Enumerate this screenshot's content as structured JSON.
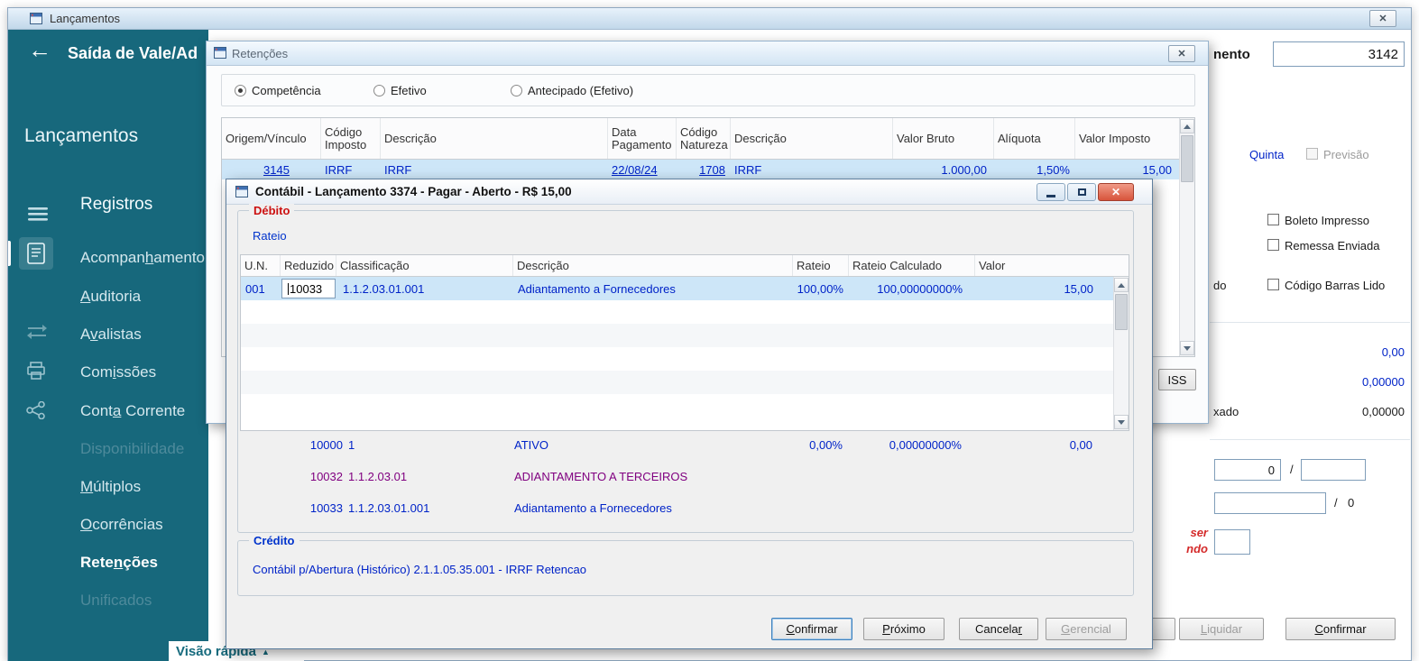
{
  "colors": {
    "sidebar_teal": "#17687c",
    "selection_blue": "#cde6f8",
    "link_blue": "#0023c8",
    "debito_red": "#cc1111",
    "credito_blue": "#0033cc",
    "detail_purple": "#800080",
    "close_red": "#d8543c"
  },
  "main_window": {
    "title": "Lançamentos",
    "close_glyph": "✕"
  },
  "sidebar": {
    "back_glyph": "←",
    "header": "Saída de Vale/Ad",
    "title": "Lançamentos",
    "section": "Registros",
    "items": [
      {
        "label": "Acompan_hamento",
        "state": "normal"
      },
      {
        "label": "_Auditoria",
        "state": "normal"
      },
      {
        "label": "A_valistas",
        "state": "normal"
      },
      {
        "label": "Com_issões",
        "state": "normal"
      },
      {
        "label": "Cont_a Corrente",
        "state": "normal"
      },
      {
        "label": "Disponibilidade",
        "state": "disabled"
      },
      {
        "label": "_Múltiplos",
        "state": "normal"
      },
      {
        "label": "_Ocorrências",
        "state": "normal"
      },
      {
        "label": "Rete_nções",
        "state": "selected"
      },
      {
        "label": "Unificados",
        "state": "disabled"
      }
    ],
    "footer": "Visão rápida",
    "footer_glyph": "▲"
  },
  "retencoes": {
    "title": "Retenções",
    "close_glyph": "✕",
    "radios": [
      {
        "label": "Competência",
        "checked": true
      },
      {
        "label": "Efetivo",
        "checked": false
      },
      {
        "label": "Antecipado (Efetivo)",
        "checked": false
      }
    ],
    "grid": {
      "columns": [
        "Origem/Vínculo",
        "Código\nImposto",
        "Descrição",
        "Data\nPagamento",
        "Código\nNatureza",
        "Descrição",
        "Valor Bruto",
        "Alíquota",
        "Valor Imposto"
      ],
      "row": [
        "3145",
        "IRRF",
        "IRRF",
        "22/08/24",
        "1708",
        "IRRF",
        "1.000,00",
        "1,50%",
        "15,00"
      ]
    },
    "iss_button": "ISS"
  },
  "contabil": {
    "title": "Contábil - Lançamento 3374 - Pagar - Aberto - R$ 15,00",
    "close_glyph": "✕",
    "debito_label": "Débito",
    "rateio_label": "Rateio",
    "grid": {
      "columns": [
        "U.N.",
        "Reduzido",
        "Classificação",
        "Descrição",
        "Rateio",
        "Rateio Calculado",
        "Valor"
      ],
      "row": [
        "001",
        "10033",
        "1.1.2.03.01.001",
        "Adiantamento a Fornecedores",
        "100,00%",
        "100,00000000%",
        "15,00"
      ]
    },
    "detail_rows": [
      {
        "reduzido": "10000",
        "classificacao": "1",
        "descricao": "ATIVO",
        "rateio": "0,00%",
        "rateio_calculado": "0,00000000%",
        "valor": "0,00"
      },
      {
        "reduzido": "10032",
        "classificacao": "1.1.2.03.01",
        "descricao": "ADIANTAMENTO A TERCEIROS",
        "rateio": "",
        "rateio_calculado": "",
        "valor": ""
      },
      {
        "reduzido": "10033",
        "classificacao": "1.1.2.03.01.001",
        "descricao": "Adiantamento a Fornecedores",
        "rateio": "",
        "rateio_calculado": "",
        "valor": ""
      }
    ],
    "credito_label": "Crédito",
    "credito_text": "Contábil p/Abertura (Histórico) 2.1.1.05.35.001 - IRRF Retencao",
    "buttons": [
      "_Confirmar",
      "_Próximo",
      "Cancela_r",
      "_Gerencial"
    ]
  },
  "right_panel": {
    "doc_label_fragment": "nento",
    "doc_number": "3142",
    "quinta_label": "Quinta",
    "previsao_label": "Previsão",
    "boleto_label": "Boleto Impresso",
    "remessa_label": "Remessa Enviada",
    "do_fragment": "do",
    "barras_label": "Código Barras Lido",
    "value_row1": "0,00",
    "value_row2": "0,00000",
    "xado_fragment": "xado",
    "value_row3": "0,00000",
    "frac1_value": "0",
    "slash": "/",
    "frac2_value": "0",
    "red_fragment_line1": "ser",
    "red_fragment_line2": "ndo",
    "liquidar_button": "_Liquidar",
    "confirmar_button": "_Confirmar"
  }
}
